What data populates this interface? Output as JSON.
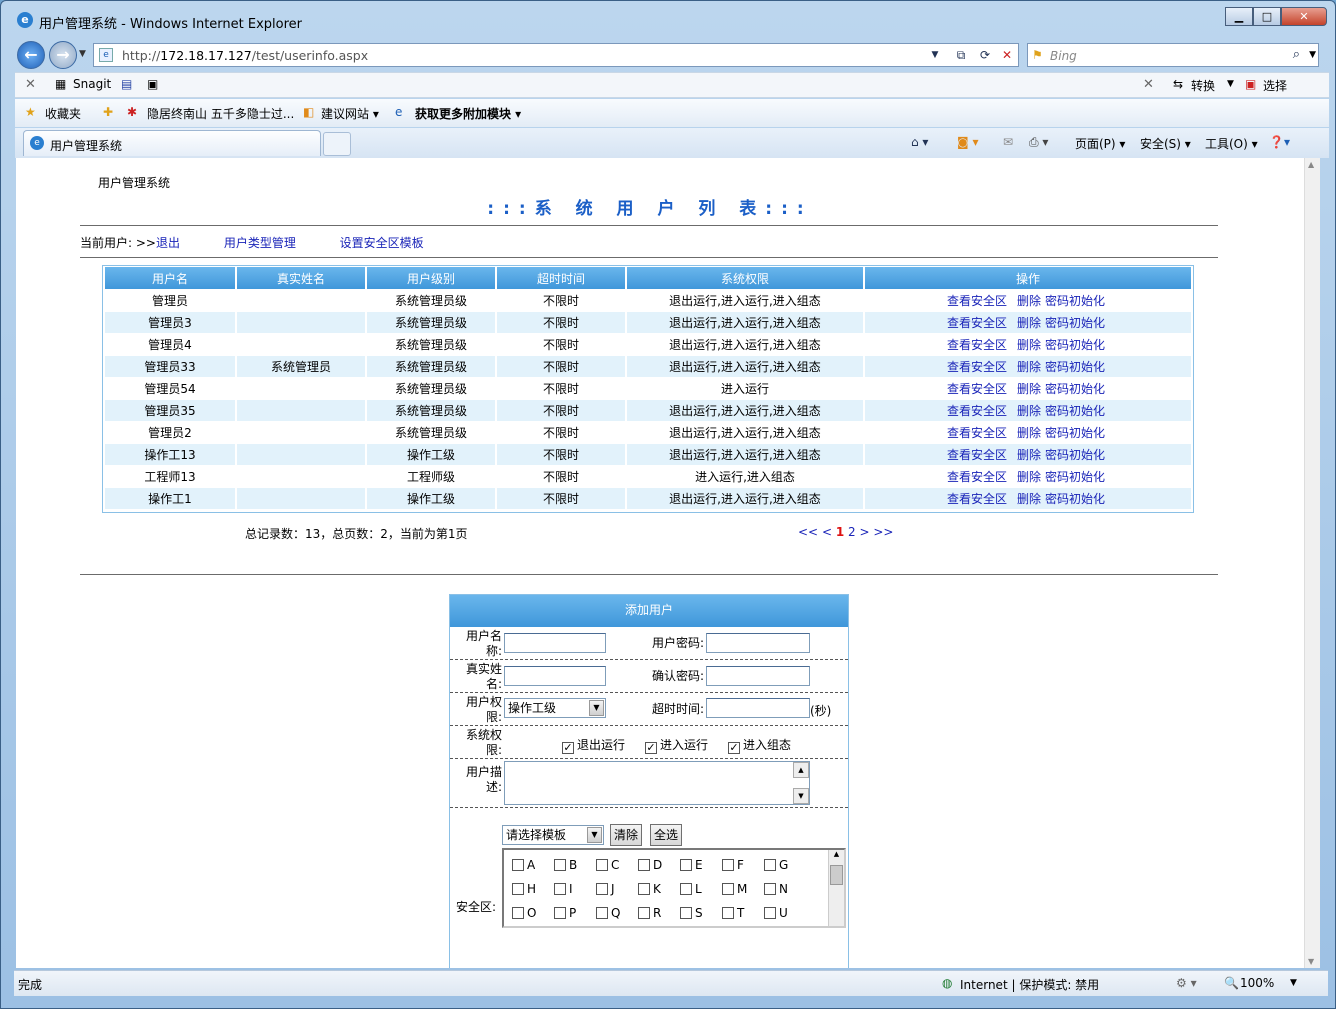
{
  "window": {
    "title": "用户管理系统 - Windows Internet Explorer",
    "minimize": "▁",
    "maximize": "□",
    "close": "✕"
  },
  "browser": {
    "url_prefix": "http://",
    "url_host": "172.18.17.127",
    "url_path": "/test/userinfo.aspx",
    "search_placeholder": "Bing",
    "cmd_items": [
      "Snagit",
      "转换",
      "选择"
    ],
    "fav_label": "收藏夹",
    "fav_links": [
      "隐居终南山 五千多隐士过...",
      "建议网站 ▾",
      "获取更多附加模块 ▾"
    ],
    "tab_title": "用户管理系统",
    "toolbar": [
      "页面(P) ▾",
      "安全(S) ▾",
      "工具(O) ▾"
    ],
    "status_left": "完成",
    "status_zone": "Internet | 保护模式: 禁用",
    "zoom": "100%"
  },
  "page": {
    "system_name": "用户管理系统",
    "title": ":::系 统 用 户 列 表:::",
    "current_user_label": "当前用户: >>",
    "logout": "退出",
    "user_type_link": "用户类型管理",
    "zone_template_link": "设置安全区模板",
    "columns": [
      "用户名",
      "真实姓名",
      "用户级别",
      "超时时间",
      "系统权限",
      "操作"
    ],
    "rows": [
      [
        "管理员",
        "",
        "系统管理员级",
        "不限时",
        "退出运行,进入运行,进入组态"
      ],
      [
        "管理员3",
        "",
        "系统管理员级",
        "不限时",
        "退出运行,进入运行,进入组态"
      ],
      [
        "管理员4",
        "",
        "系统管理员级",
        "不限时",
        "退出运行,进入运行,进入组态"
      ],
      [
        "管理员33",
        "系统管理员",
        "系统管理员级",
        "不限时",
        "退出运行,进入运行,进入组态"
      ],
      [
        "管理员54",
        "",
        "系统管理员级",
        "不限时",
        "进入运行"
      ],
      [
        "管理员35",
        "",
        "系统管理员级",
        "不限时",
        "退出运行,进入运行,进入组态"
      ],
      [
        "管理员2",
        "",
        "系统管理员级",
        "不限时",
        "退出运行,进入运行,进入组态"
      ],
      [
        "操作工13",
        "",
        "操作工级",
        "不限时",
        "退出运行,进入运行,进入组态"
      ],
      [
        "工程师13",
        "",
        "工程师级",
        "不限时",
        "进入运行,进入组态"
      ],
      [
        "操作工1",
        "",
        "操作工级",
        "不限时",
        "退出运行,进入运行,进入组态"
      ]
    ],
    "actions": [
      "查看安全区",
      "删除",
      "密码初始化"
    ],
    "summary": "总记录数：13，总页数：2，当前为第1页",
    "pager": {
      "first": "<<",
      "prev": "<",
      "current": "1",
      "page2": "2",
      "next": ">",
      "last": ">>"
    }
  },
  "form": {
    "header": "添加用户",
    "username_label": "用户名称:",
    "password_label": "用户密码:",
    "realname_label": "真实姓名:",
    "confirm_label": "确认密码:",
    "level_label": "用户权限:",
    "level_value": "操作工级",
    "timeout_label": "超时时间:",
    "timeout_unit": "(秒)",
    "perm_label": "系统权限:",
    "perms": [
      "退出运行",
      "进入运行",
      "进入组态"
    ],
    "desc_label": "用户描述:",
    "template_value": "请选择模板",
    "clear_btn": "清除",
    "all_btn": "全选",
    "zone_label": "安全区:",
    "zones": [
      "A",
      "B",
      "C",
      "D",
      "E",
      "F",
      "G",
      "H",
      "I",
      "J",
      "K",
      "L",
      "M",
      "N",
      "O",
      "P",
      "Q",
      "R",
      "S",
      "T",
      "U"
    ]
  }
}
